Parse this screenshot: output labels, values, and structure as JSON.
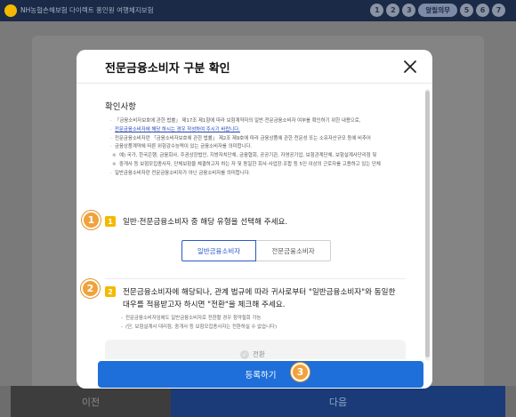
{
  "topbar": {
    "brand": "NH농협손해보험 다이렉트",
    "sub_brand": "홍인원 여행체지보험",
    "steps": [
      "1",
      "2",
      "3"
    ],
    "current_step": "알릴의무",
    "next_steps": [
      "5",
      "6",
      "7"
    ]
  },
  "modal": {
    "title": "전문금융소비자 구분 확인",
    "notice_title": "확인사항",
    "notices": [
      {
        "text": "「금융소비자보호에 관한 법률」 제17조 제1항에 따라 보험계약자의 일반·전문금융소비자 여부를 확인하기 위한 내용으로,"
      },
      {
        "text": "전문금융소비자에 해당 하시는 경우 작성하여 주시기 바랍니다.",
        "link": true
      },
      {
        "text": "전문금융소비자란 「금융소비자보호에 관한 법률」 제2조 제9호에 따라 금융상품에 관한 전문성 또는 소유자산규모 등에 비추어"
      },
      {
        "text": "금융상품계약에 따른 위험감수능력이 있는 금융소비자를 의미합니다."
      },
      {
        "text": "예) 국가, 한국은행, 금융회사, 주권상장법인, 지방자치단체, 금융협회, 공공기관, 자영공기업, 보험관계단체, 보험설계사단리점 및",
        "sub": true
      },
      {
        "text": "중개사 등 보험모집종사자, 단체보험을 체결하고자 하는 자 및 동일한 회사·사업장·조합 등 5인 이상의 근로자를 고용하고 있는 단체",
        "sub": true,
        "cont": true
      },
      {
        "text": "일반금융소비자란 전문금융소비자가 아닌 금융소비자를 의미합니다."
      }
    ],
    "q1": {
      "number": "1",
      "text": "일반·전문금융소비자 중 해당 유형을 선택해 주세요.",
      "options": [
        "일반금융소비자",
        "전문금융소비자"
      ],
      "selected": "일반금융소비자"
    },
    "q2": {
      "number": "2",
      "text": "전문금융소비자에 해당되나, 관계 법규에 따라 귀사로부터 \"일반금융소비자\"와 동일한 대우를 적용받고자 하시면 \"전환\"을 체크해 주세요.",
      "notes": [
        "전문금융소비자임에도 일반금융소비자로 전환할 경우 청약철회 가능",
        "(단, 보험설계사 대리점, 중개사 등 보험모집종사자는 전환하실 수 없습니다)"
      ],
      "checkbox_label": "전환"
    },
    "submit_label": "등록하기"
  },
  "bottom": {
    "prev_label": "이전",
    "next_label": "다음"
  },
  "callouts": [
    "1",
    "2",
    "3"
  ],
  "colors": {
    "accent_blue": "#1e6fd9",
    "badge_yellow": "#f5b800",
    "callout_orange": "#f0a23c",
    "navy": "#1a2a47"
  }
}
